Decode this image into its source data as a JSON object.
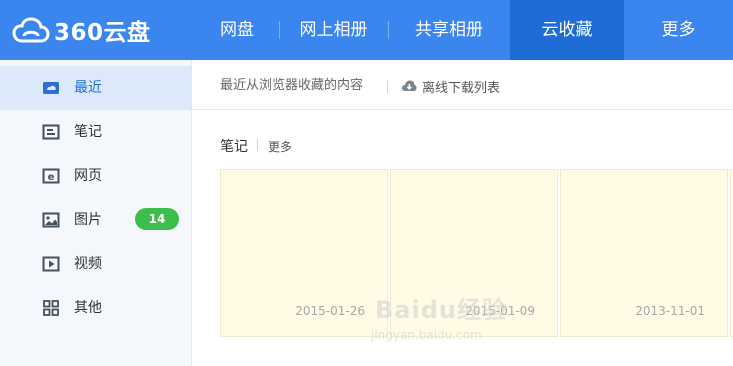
{
  "brand": {
    "name": "360云盘",
    "logo_icon": "cloud-logo-icon",
    "color": "#3a86ee"
  },
  "nav": {
    "items": [
      {
        "label": "网盘"
      },
      {
        "label": "网上相册"
      },
      {
        "label": "共享相册"
      },
      {
        "label": "云收藏",
        "active": true
      },
      {
        "label": "更多"
      }
    ]
  },
  "sidebar": {
    "items": [
      {
        "label": "最近",
        "icon": "recent-icon",
        "active": true
      },
      {
        "label": "笔记",
        "icon": "note-icon"
      },
      {
        "label": "网页",
        "icon": "webpage-icon"
      },
      {
        "label": "图片",
        "icon": "image-icon",
        "badge": "14"
      },
      {
        "label": "视频",
        "icon": "video-icon"
      },
      {
        "label": "其他",
        "icon": "grid-icon"
      }
    ],
    "badge_color": "#3cbf4a"
  },
  "toolbar": {
    "hint": "最近从浏览器收藏的内容",
    "offline_download": "离线下载列表",
    "offline_icon": "cloud-download-icon"
  },
  "section": {
    "title": "笔记",
    "more": "更多"
  },
  "notes": [
    {
      "date": "2015-01-26"
    },
    {
      "date": "2015-01-09"
    },
    {
      "date": "2013-11-01"
    }
  ],
  "watermark": {
    "main": "Baidu经验",
    "sub": "jingyan.baidu.com"
  }
}
